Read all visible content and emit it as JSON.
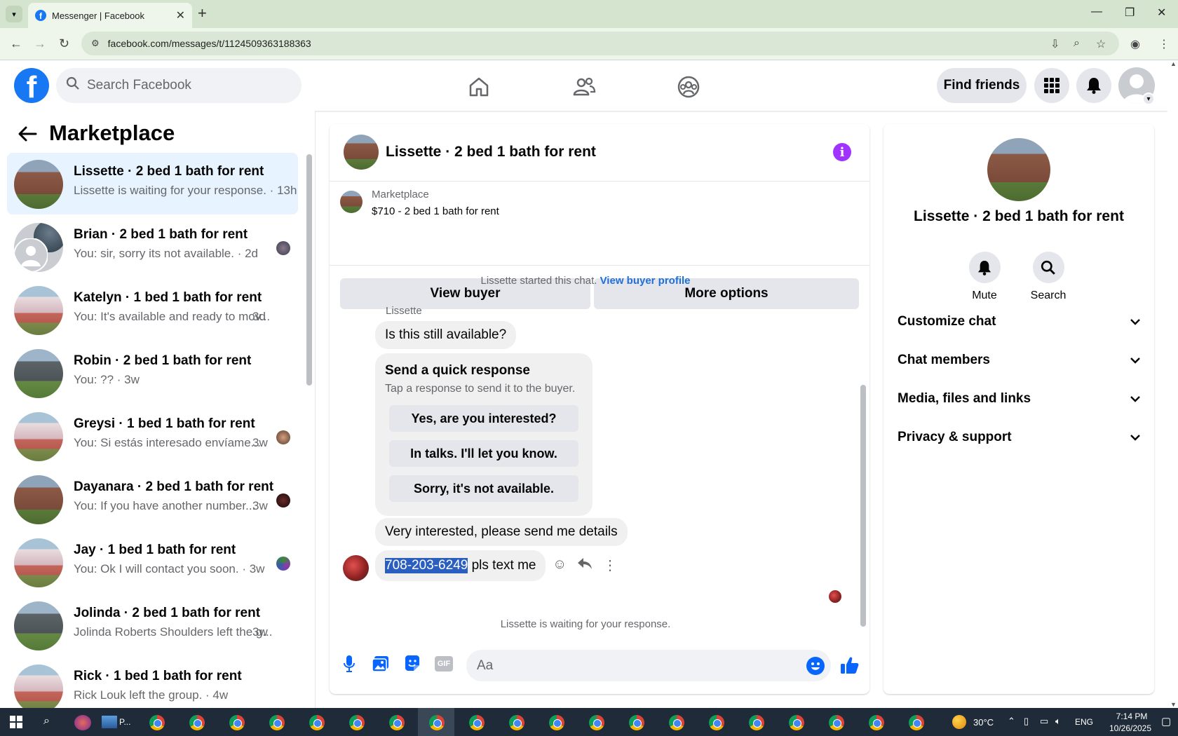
{
  "browser": {
    "tab_title": "Messenger | Facebook",
    "url": "facebook.com/messages/t/1124509363188363"
  },
  "fb_header": {
    "search_placeholder": "Search Facebook",
    "find_friends": "Find friends"
  },
  "sidebar": {
    "title": "Marketplace",
    "conversations": [
      {
        "name": "Lissette · 2 bed 1 bath for rent",
        "preview": "Lissette is waiting for your response. · 13h",
        "time": "",
        "active": true
      },
      {
        "name": "Brian · 2 bed 1 bath for rent",
        "preview": "You: sir, sorry its not available. · 2d",
        "time": ""
      },
      {
        "name": "Katelyn · 1 bed 1 bath for rent",
        "preview": "You: It's available and ready to mov...",
        "time": "3d"
      },
      {
        "name": "Robin · 2 bed 1 bath for rent",
        "preview": "You: ?? · 3w",
        "time": ""
      },
      {
        "name": "Greysi · 1 bed 1 bath for rent",
        "preview": "You: Si estás interesado envíame...",
        "time": "3w"
      },
      {
        "name": "Dayanara · 2 bed 1 bath for rent",
        "preview": "You: If you have another number...",
        "time": "3w"
      },
      {
        "name": "Jay · 1 bed 1 bath for rent",
        "preview": "You: Ok I will contact you soon. · 3w",
        "time": ""
      },
      {
        "name": "Jolinda · 2 bed 1 bath for rent",
        "preview": "Jolinda Roberts Shoulders left the g...",
        "time": "3w"
      },
      {
        "name": "Rick · 1 bed 1 bath for rent",
        "preview": "Rick Louk left the group. · 4w",
        "time": ""
      }
    ]
  },
  "chat": {
    "title": "Lissette · 2 bed 1 bath for rent",
    "listing_label": "Marketplace",
    "listing_price": "$710 - 2 bed 1 bath for rent",
    "view_buyer": "View buyer",
    "more_options": "More options",
    "started_text": "Lissette started this chat.",
    "view_buyer_profile": "View buyer profile",
    "sender_name": "Lissette",
    "msg1": "Is this still available?",
    "quick_title": "Send a quick response",
    "quick_sub": "Tap a response to send it to the buyer.",
    "quick_options": [
      "Yes, are you interested?",
      "In talks. I'll let you know.",
      "Sorry, it's not available."
    ],
    "msg2": "Very interested, please send me details",
    "msg3_selected": "708-203-6249",
    "msg3_rest": " pls text me",
    "waiting": "Lissette is waiting for your response.",
    "composer_placeholder": "Aa"
  },
  "details": {
    "name": "Lissette · 2 bed 1 bath for rent",
    "mute": "Mute",
    "search": "Search",
    "sections": [
      "Customize chat",
      "Chat members",
      "Media, files and links",
      "Privacy & support"
    ]
  },
  "taskbar": {
    "first_app_label": "P...",
    "temp": "30°C",
    "lang": "ENG",
    "time": "7:14 PM",
    "date": "10/26/2025"
  }
}
